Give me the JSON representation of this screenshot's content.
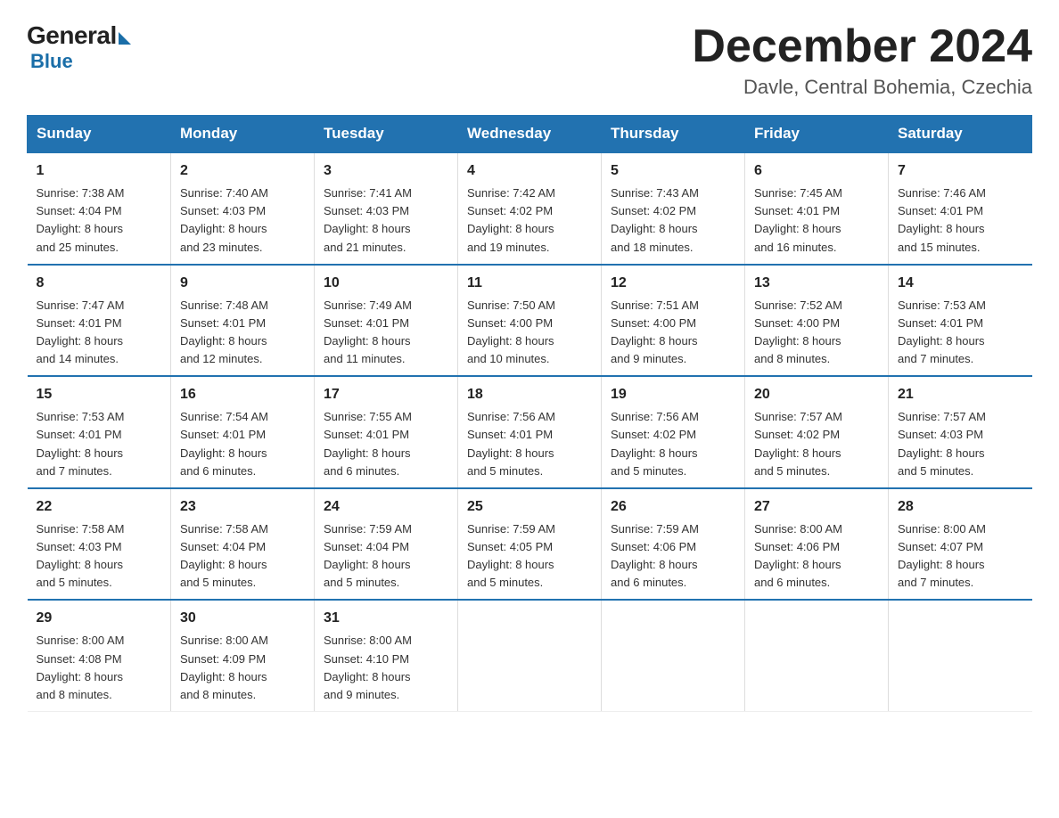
{
  "logo": {
    "general": "General",
    "blue": "Blue"
  },
  "title": "December 2024",
  "subtitle": "Davle, Central Bohemia, Czechia",
  "days_header": [
    "Sunday",
    "Monday",
    "Tuesday",
    "Wednesday",
    "Thursday",
    "Friday",
    "Saturday"
  ],
  "weeks": [
    [
      {
        "day": "1",
        "info": "Sunrise: 7:38 AM\nSunset: 4:04 PM\nDaylight: 8 hours\nand 25 minutes."
      },
      {
        "day": "2",
        "info": "Sunrise: 7:40 AM\nSunset: 4:03 PM\nDaylight: 8 hours\nand 23 minutes."
      },
      {
        "day": "3",
        "info": "Sunrise: 7:41 AM\nSunset: 4:03 PM\nDaylight: 8 hours\nand 21 minutes."
      },
      {
        "day": "4",
        "info": "Sunrise: 7:42 AM\nSunset: 4:02 PM\nDaylight: 8 hours\nand 19 minutes."
      },
      {
        "day": "5",
        "info": "Sunrise: 7:43 AM\nSunset: 4:02 PM\nDaylight: 8 hours\nand 18 minutes."
      },
      {
        "day": "6",
        "info": "Sunrise: 7:45 AM\nSunset: 4:01 PM\nDaylight: 8 hours\nand 16 minutes."
      },
      {
        "day": "7",
        "info": "Sunrise: 7:46 AM\nSunset: 4:01 PM\nDaylight: 8 hours\nand 15 minutes."
      }
    ],
    [
      {
        "day": "8",
        "info": "Sunrise: 7:47 AM\nSunset: 4:01 PM\nDaylight: 8 hours\nand 14 minutes."
      },
      {
        "day": "9",
        "info": "Sunrise: 7:48 AM\nSunset: 4:01 PM\nDaylight: 8 hours\nand 12 minutes."
      },
      {
        "day": "10",
        "info": "Sunrise: 7:49 AM\nSunset: 4:01 PM\nDaylight: 8 hours\nand 11 minutes."
      },
      {
        "day": "11",
        "info": "Sunrise: 7:50 AM\nSunset: 4:00 PM\nDaylight: 8 hours\nand 10 minutes."
      },
      {
        "day": "12",
        "info": "Sunrise: 7:51 AM\nSunset: 4:00 PM\nDaylight: 8 hours\nand 9 minutes."
      },
      {
        "day": "13",
        "info": "Sunrise: 7:52 AM\nSunset: 4:00 PM\nDaylight: 8 hours\nand 8 minutes."
      },
      {
        "day": "14",
        "info": "Sunrise: 7:53 AM\nSunset: 4:01 PM\nDaylight: 8 hours\nand 7 minutes."
      }
    ],
    [
      {
        "day": "15",
        "info": "Sunrise: 7:53 AM\nSunset: 4:01 PM\nDaylight: 8 hours\nand 7 minutes."
      },
      {
        "day": "16",
        "info": "Sunrise: 7:54 AM\nSunset: 4:01 PM\nDaylight: 8 hours\nand 6 minutes."
      },
      {
        "day": "17",
        "info": "Sunrise: 7:55 AM\nSunset: 4:01 PM\nDaylight: 8 hours\nand 6 minutes."
      },
      {
        "day": "18",
        "info": "Sunrise: 7:56 AM\nSunset: 4:01 PM\nDaylight: 8 hours\nand 5 minutes."
      },
      {
        "day": "19",
        "info": "Sunrise: 7:56 AM\nSunset: 4:02 PM\nDaylight: 8 hours\nand 5 minutes."
      },
      {
        "day": "20",
        "info": "Sunrise: 7:57 AM\nSunset: 4:02 PM\nDaylight: 8 hours\nand 5 minutes."
      },
      {
        "day": "21",
        "info": "Sunrise: 7:57 AM\nSunset: 4:03 PM\nDaylight: 8 hours\nand 5 minutes."
      }
    ],
    [
      {
        "day": "22",
        "info": "Sunrise: 7:58 AM\nSunset: 4:03 PM\nDaylight: 8 hours\nand 5 minutes."
      },
      {
        "day": "23",
        "info": "Sunrise: 7:58 AM\nSunset: 4:04 PM\nDaylight: 8 hours\nand 5 minutes."
      },
      {
        "day": "24",
        "info": "Sunrise: 7:59 AM\nSunset: 4:04 PM\nDaylight: 8 hours\nand 5 minutes."
      },
      {
        "day": "25",
        "info": "Sunrise: 7:59 AM\nSunset: 4:05 PM\nDaylight: 8 hours\nand 5 minutes."
      },
      {
        "day": "26",
        "info": "Sunrise: 7:59 AM\nSunset: 4:06 PM\nDaylight: 8 hours\nand 6 minutes."
      },
      {
        "day": "27",
        "info": "Sunrise: 8:00 AM\nSunset: 4:06 PM\nDaylight: 8 hours\nand 6 minutes."
      },
      {
        "day": "28",
        "info": "Sunrise: 8:00 AM\nSunset: 4:07 PM\nDaylight: 8 hours\nand 7 minutes."
      }
    ],
    [
      {
        "day": "29",
        "info": "Sunrise: 8:00 AM\nSunset: 4:08 PM\nDaylight: 8 hours\nand 8 minutes."
      },
      {
        "day": "30",
        "info": "Sunrise: 8:00 AM\nSunset: 4:09 PM\nDaylight: 8 hours\nand 8 minutes."
      },
      {
        "day": "31",
        "info": "Sunrise: 8:00 AM\nSunset: 4:10 PM\nDaylight: 8 hours\nand 9 minutes."
      },
      {
        "day": "",
        "info": ""
      },
      {
        "day": "",
        "info": ""
      },
      {
        "day": "",
        "info": ""
      },
      {
        "day": "",
        "info": ""
      }
    ]
  ]
}
